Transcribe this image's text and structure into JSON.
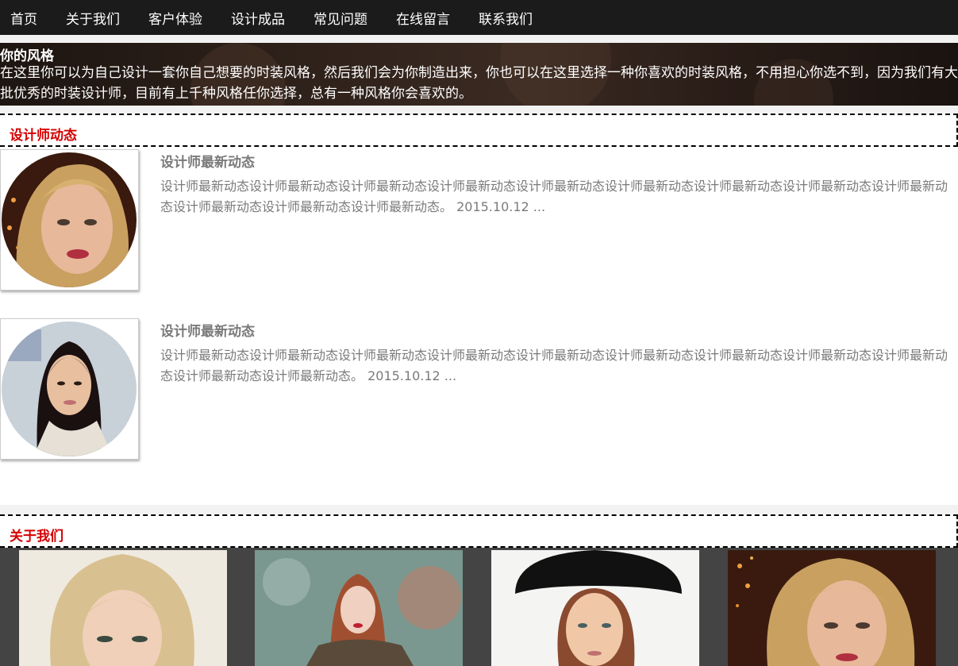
{
  "nav": {
    "items": [
      "首页",
      "关于我们",
      "客户体验",
      "设计成品",
      "常见问题",
      "在线留言",
      "联系我们"
    ]
  },
  "banner": {
    "title": "你的风格",
    "text": "在这里你可以为自己设计一套你自己想要的时装风格，然后我们会为你制造出来，你也可以在这里选择一种你喜欢的时装风格，不用担心你选不到，因为我们有大批优秀的时装设计师，目前有上千种风格任你选择，总有一种风格你会喜欢的。"
  },
  "news_section": {
    "heading": "设计师动态",
    "items": [
      {
        "title": "设计师最新动态",
        "body": "设计师最新动态设计师最新动态设计师最新动态设计师最新动态设计师最新动态设计师最新动态设计师最新动态设计师最新动态设计师最新动态设计师最新动态设计师最新动态设计师最新动态。 2015.10.12 ..."
      },
      {
        "title": "设计师最新动态",
        "body": "设计师最新动态设计师最新动态设计师最新动态设计师最新动态设计师最新动态设计师最新动态设计师最新动态设计师最新动态设计师最新动态设计师最新动态设计师最新动态。 2015.10.12 ..."
      }
    ]
  },
  "about_section": {
    "heading": "关于我们"
  },
  "colors": {
    "nav_bg": "#1b1b1b",
    "accent_red": "#d40000",
    "body_text": "#7a7a7a",
    "about_bg": "#444444"
  }
}
